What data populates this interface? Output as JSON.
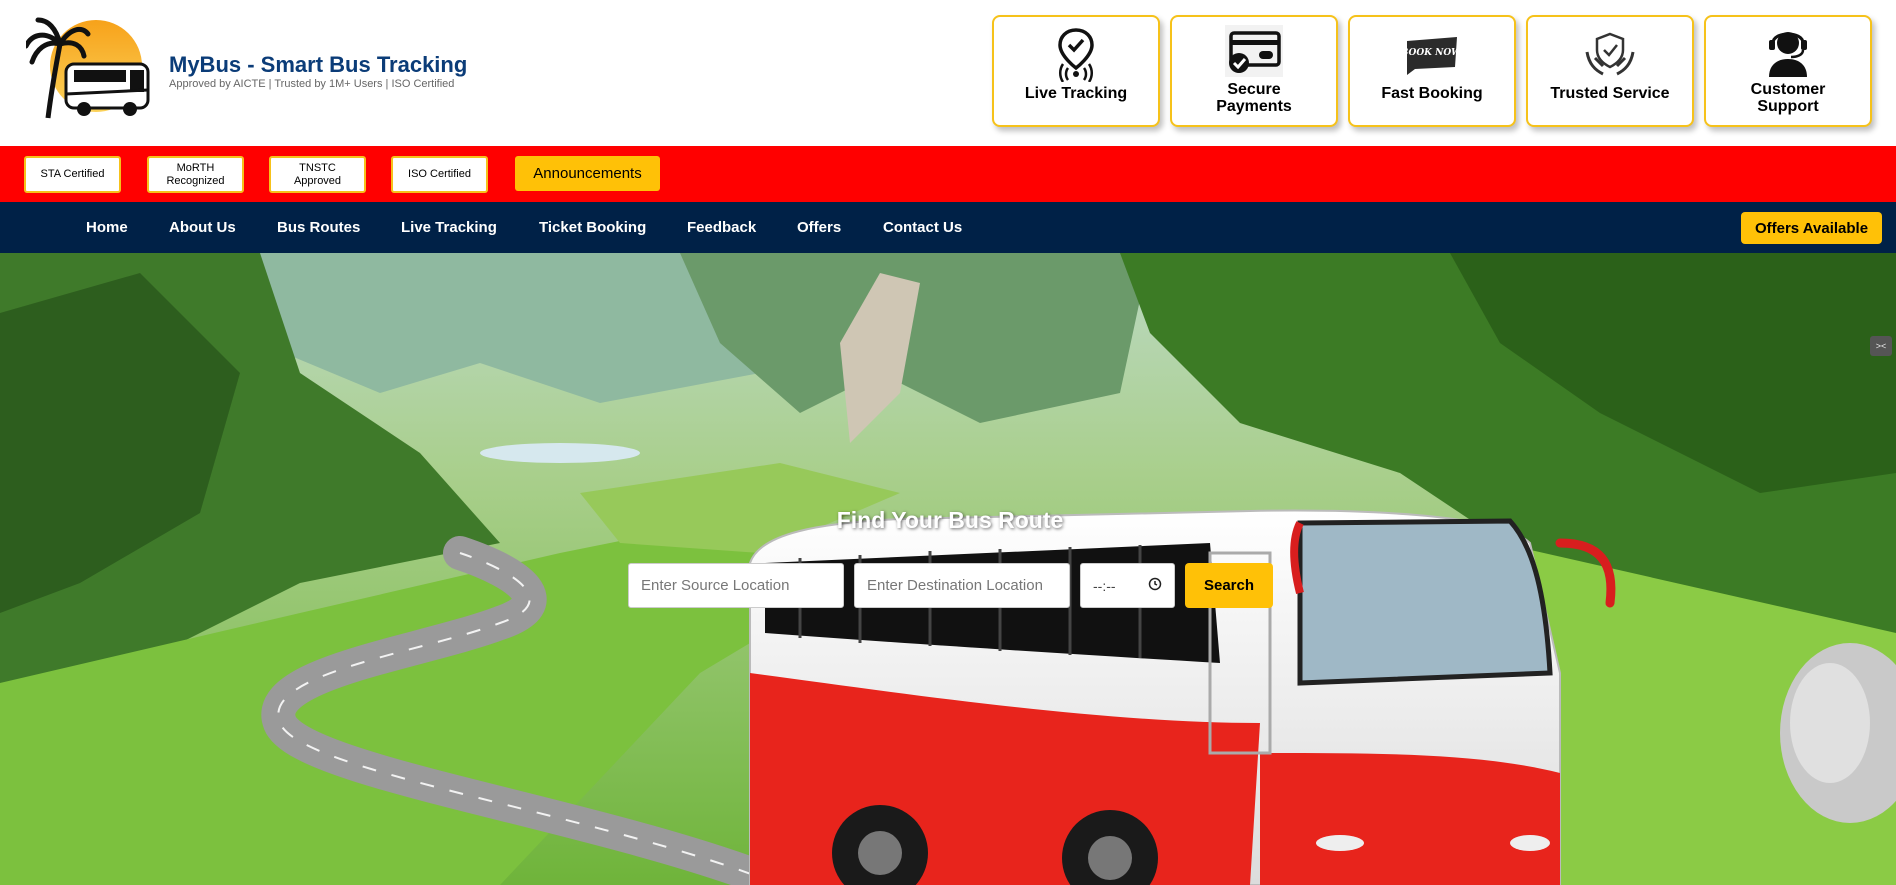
{
  "brand": {
    "title": "MyBus - Smart Bus Tracking",
    "subtitle": "Approved by AICTE | Trusted by 1M+ Users | ISO Certified"
  },
  "features": [
    {
      "label": "Live Tracking",
      "icon": "location-pin-icon"
    },
    {
      "label": "Secure Payments",
      "icon": "card-check-icon"
    },
    {
      "label": "Fast Booking",
      "icon": "book-now-icon"
    },
    {
      "label": "Trusted Service",
      "icon": "shield-hands-icon"
    },
    {
      "label": "Customer Support",
      "icon": "headset-icon"
    }
  ],
  "certifications": [
    "STA Certified",
    "MoRTH Recognized",
    "TNSTC Approved",
    "ISO Certified"
  ],
  "announcements_label": "Announcements",
  "nav": {
    "items": [
      "Home",
      "About Us",
      "Bus Routes",
      "Live Tracking",
      "Ticket Booking",
      "Feedback",
      "Offers",
      "Contact Us"
    ],
    "offers_button": "Offers Available"
  },
  "hero": {
    "title": "Find Your Bus Route",
    "source_placeholder": "Enter Source Location",
    "destination_placeholder": "Enter Destination Location",
    "time_value": "--:--",
    "search_label": "Search"
  },
  "colors": {
    "brand_blue": "#0b3c78",
    "accent_yellow": "#ffc107",
    "cert_bar_red": "#ff0000",
    "nav_navy": "#002147"
  }
}
